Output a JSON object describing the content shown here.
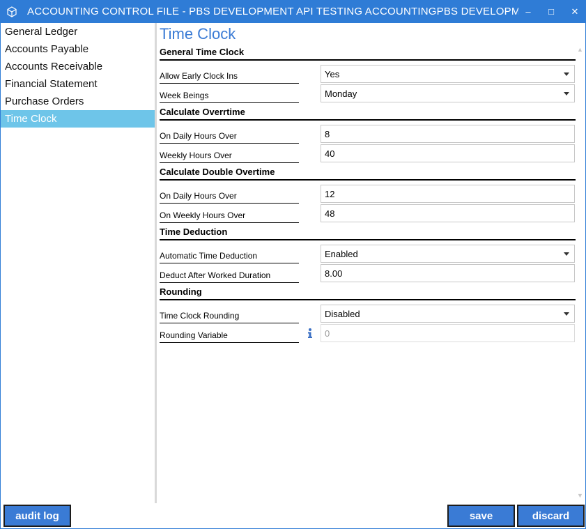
{
  "window": {
    "title": "ACCOUNTING CONTROL FILE - PBS DEVELOPMENT API TESTING ACCOUNTINGPBS DEVELOPMENT A...",
    "minimize_glyph": "–",
    "maximize_glyph": "□",
    "close_glyph": "✕",
    "accent_color": "#2f7cd6"
  },
  "sidebar": {
    "items": [
      {
        "label": "General Ledger"
      },
      {
        "label": "Accounts Payable"
      },
      {
        "label": "Accounts Receivable"
      },
      {
        "label": "Financial Statement"
      },
      {
        "label": "Purchase Orders"
      },
      {
        "label": "Time Clock",
        "active": true
      }
    ],
    "active_color": "#6ec5e9"
  },
  "main": {
    "title": "Time Clock",
    "sections": {
      "general": {
        "heading": "General Time Clock",
        "allow_early_label": "Allow Early Clock Ins",
        "allow_early_value": "Yes",
        "week_begins_label": "Week Beings",
        "week_begins_value": "Monday"
      },
      "overtime": {
        "heading": "Calculate Overrtime",
        "daily_label": "On Daily Hours Over",
        "daily_value": "8",
        "weekly_label": "Weekly Hours Over",
        "weekly_value": "40"
      },
      "double_overtime": {
        "heading": "Calculate Double Overtime",
        "daily_label": " On Daily Hours Over",
        "daily_value": "12",
        "weekly_label": "On Weekly Hours Over",
        "weekly_value": "48"
      },
      "deduction": {
        "heading": "Time Deduction",
        "auto_label": "Automatic Time Deduction",
        "auto_value": "Enabled",
        "after_label": "Deduct After Worked Duration",
        "after_value": "8.00"
      },
      "rounding": {
        "heading": "Rounding",
        "rounding_label": "Time Clock Rounding",
        "rounding_value": "Disabled",
        "variable_label": "Rounding Variable",
        "variable_value": "0"
      }
    }
  },
  "footer": {
    "audit_log": "audit log",
    "save": "save",
    "discard": "discard",
    "button_color": "#3a7bd5"
  }
}
